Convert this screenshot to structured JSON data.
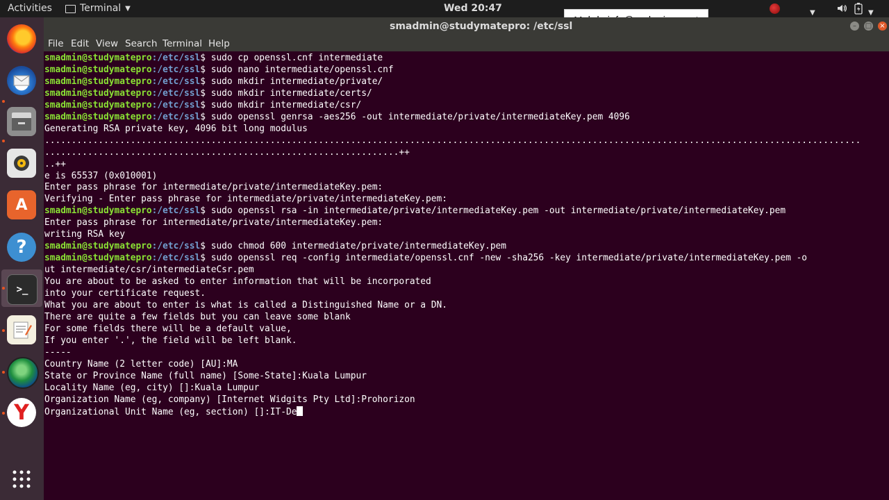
{
  "topbar": {
    "activities": "Activities",
    "app_name": "Terminal",
    "clock": "Wed 20:47",
    "icons": [
      "record-icon",
      "dropdown-arrow-icon",
      "volume-icon",
      "battery-icon",
      "power-menu-icon"
    ]
  },
  "tooltip": "Mohd : info@prohorizon.net",
  "window": {
    "title": "smadmin@studymatepro: /etc/ssl",
    "menu": [
      "File",
      "Edit",
      "View",
      "Search",
      "Terminal",
      "Help"
    ]
  },
  "dock": [
    "firefox-icon",
    "thunderbird-icon",
    "files-icon",
    "rhythmbox-icon",
    "software-center-icon",
    "help-icon",
    "terminal-icon",
    "text-editor-icon",
    "browser-globe-icon",
    "yandex-icon",
    "show-apps-icon"
  ],
  "terminal": {
    "prompt_user": "smadmin@studymatepro",
    "prompt_path": ":/etc/ssl",
    "prompt_symbol": "$ ",
    "lines": [
      {
        "prompt": true,
        "text": "sudo cp openssl.cnf intermediate"
      },
      {
        "prompt": true,
        "text": "sudo nano intermediate/openssl.cnf"
      },
      {
        "prompt": true,
        "text": "sudo mkdir intermediate/private/"
      },
      {
        "prompt": true,
        "text": "sudo mkdir intermediate/certs/"
      },
      {
        "prompt": true,
        "text": "sudo mkdir intermediate/csr/"
      },
      {
        "prompt": true,
        "text": "sudo openssl genrsa -aes256 -out intermediate/private/intermediateKey.pem 4096"
      },
      {
        "prompt": false,
        "text": "Generating RSA private key, 4096 bit long modulus"
      },
      {
        "prompt": false,
        "text": "........................................................................................................................................................"
      },
      {
        "prompt": false,
        "text": "..................................................................++"
      },
      {
        "prompt": false,
        "text": "..++"
      },
      {
        "prompt": false,
        "text": "e is 65537 (0x010001)"
      },
      {
        "prompt": false,
        "text": "Enter pass phrase for intermediate/private/intermediateKey.pem:"
      },
      {
        "prompt": false,
        "text": "Verifying - Enter pass phrase for intermediate/private/intermediateKey.pem:"
      },
      {
        "prompt": true,
        "text": "sudo openssl rsa -in intermediate/private/intermediateKey.pem -out intermediate/private/intermediateKey.pem"
      },
      {
        "prompt": false,
        "text": "Enter pass phrase for intermediate/private/intermediateKey.pem:"
      },
      {
        "prompt": false,
        "text": "writing RSA key"
      },
      {
        "prompt": true,
        "text": "sudo chmod 600 intermediate/private/intermediateKey.pem"
      },
      {
        "prompt": true,
        "text": "sudo openssl req -config intermediate/openssl.cnf -new -sha256 -key intermediate/private/intermediateKey.pem -o"
      },
      {
        "prompt": false,
        "text": "ut intermediate/csr/intermediateCsr.pem"
      },
      {
        "prompt": false,
        "text": "You are about to be asked to enter information that will be incorporated"
      },
      {
        "prompt": false,
        "text": "into your certificate request."
      },
      {
        "prompt": false,
        "text": "What you are about to enter is what is called a Distinguished Name or a DN."
      },
      {
        "prompt": false,
        "text": "There are quite a few fields but you can leave some blank"
      },
      {
        "prompt": false,
        "text": "For some fields there will be a default value,"
      },
      {
        "prompt": false,
        "text": "If you enter '.', the field will be left blank."
      },
      {
        "prompt": false,
        "text": "-----"
      },
      {
        "prompt": false,
        "text": "Country Name (2 letter code) [AU]:MA"
      },
      {
        "prompt": false,
        "text": "State or Province Name (full name) [Some-State]:Kuala Lumpur"
      },
      {
        "prompt": false,
        "text": "Locality Name (eg, city) []:Kuala Lumpur"
      },
      {
        "prompt": false,
        "text": "Organization Name (eg, company) [Internet Widgits Pty Ltd]:Prohorizon"
      },
      {
        "prompt": false,
        "text": "Organizational Unit Name (eg, section) []:IT-De",
        "cursor": true
      }
    ]
  }
}
